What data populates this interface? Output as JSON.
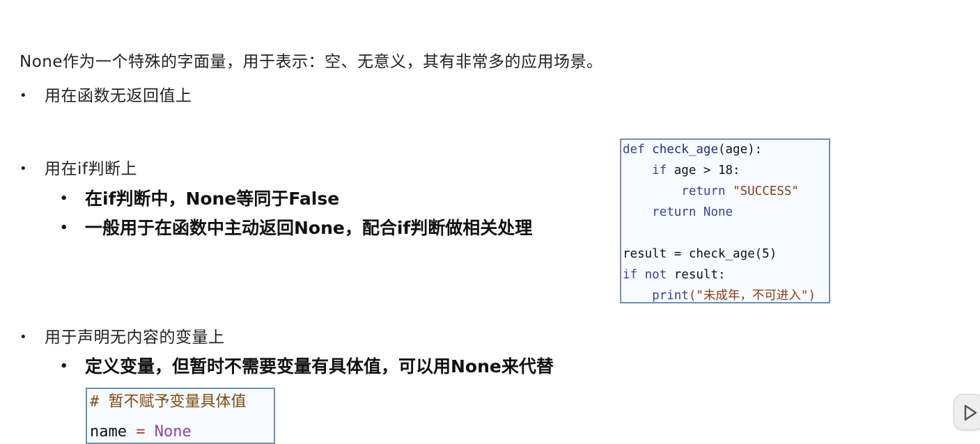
{
  "intro": "None作为一个特殊的字面量，用于表示：空、无意义，其有非常多的应用场景。",
  "bullets": [
    {
      "label": "用在函数无返回值上"
    },
    {
      "label": "用在if判断上"
    },
    {
      "label": "用于声明无内容的变量上"
    }
  ],
  "if_sub": [
    "在if判断中，None等同于False",
    "一般用于在函数中主动返回None，配合if判断做相关处理"
  ],
  "var_sub": "定义变量，但暂时不需要变量有具体值，可以用None来代替",
  "code1": {
    "line1_kw": "def",
    "line1_fn": "check_age",
    "line1_rest": "(age):",
    "line2_kw": "if",
    "line2_rest": " age > 18:",
    "line3_kw": "return",
    "line3_str": "\"SUCCESS\"",
    "line4_kw": "return",
    "line4_val": "None",
    "line6_a": "result = check_age(5)",
    "line7_kw1": "if",
    "line7_kw2": "not",
    "line7_rest": " result:",
    "line8_fn": "print",
    "line8_str": "(\"未成年，不可进入\")"
  },
  "code2": {
    "comment": "# 暂不赋予变量具体值",
    "var": "name",
    "op": "=",
    "val": "None"
  },
  "icons": {
    "play": "play-icon"
  }
}
